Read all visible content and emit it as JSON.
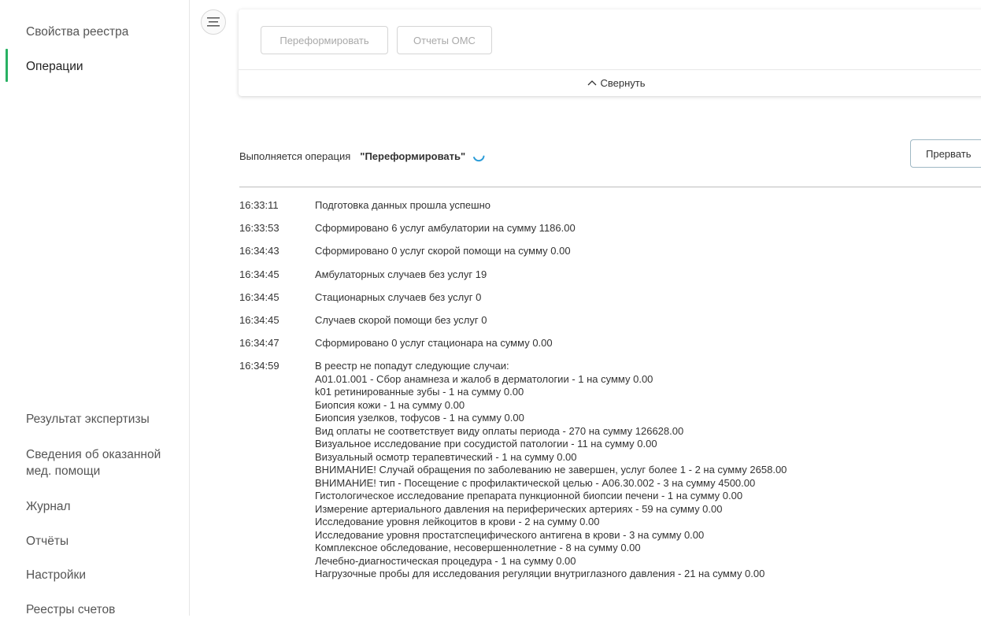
{
  "sidebar": {
    "top_items": [
      {
        "label": "Свойства реестра",
        "active": false
      },
      {
        "label": "Операции",
        "active": true
      }
    ],
    "bottom_items": [
      {
        "label": "Результат экспертизы"
      },
      {
        "label_line1": "Сведения об оказанной",
        "label_line2": "мед. помощи"
      },
      {
        "label": "Журнал"
      },
      {
        "label": "Отчёты"
      },
      {
        "label": "Настройки"
      },
      {
        "label": "Реестры счетов"
      }
    ],
    "active_color": "#28b163"
  },
  "card": {
    "buttons": [
      "Переформировать",
      "Отчеты ОМС"
    ],
    "collapse_label": "Свернуть"
  },
  "operation": {
    "prefix": "Выполняется операция",
    "name": "\"Переформировать\"",
    "abort_label": "Прервать",
    "spinner_color": "#2a9bd8"
  },
  "log": [
    {
      "time": "16:33:11",
      "text": "Подготовка данных прошла успешно"
    },
    {
      "time": "16:33:53",
      "text": "Сформировано 6 услуг амбулатории на сумму 1186.00"
    },
    {
      "time": "16:34:43",
      "text": "Сформировано 0 услуг скорой помощи на сумму 0.00"
    },
    {
      "time": "16:34:45",
      "text": "Амбулаторных случаев без услуг 19"
    },
    {
      "time": "16:34:45",
      "text": "Стационарных случаев без услуг 0"
    },
    {
      "time": "16:34:45",
      "text": "Случаев скорой помощи без услуг 0"
    },
    {
      "time": "16:34:47",
      "text": "Сформировано 0 услуг стационара на сумму 0.00"
    },
    {
      "time": "16:34:59",
      "lines": [
        "В реестр не попадут следующие случаи:",
        "A01.01.001 - Сбор анамнеза и жалоб в дерматологии - 1 на сумму 0.00",
        "k01 ретинированные зубы - 1 на сумму 0.00",
        "Биопсия кожи - 1 на сумму 0.00",
        "Биопсия узелков, тофусов - 1 на сумму 0.00",
        "Вид оплаты не соответствует виду оплаты периода - 270 на сумму 126628.00",
        "Визуальное исследование при сосудистой патологии - 11 на сумму 0.00",
        "Визуальный осмотр терапевтический - 1 на сумму 0.00",
        "ВНИМАНИЕ! Случай обращения по заболеванию не завершен, услуг более 1 - 2 на сумму 2658.00",
        "ВНИМАНИЕ! тип - Посещение с профилактической целью - A06.30.002 - 3 на сумму 4500.00",
        "Гистологическое исследование препарата пункционной биопсии печени - 1 на сумму 0.00",
        "Измерение артериального давления на периферических артериях - 59 на сумму 0.00",
        "Исследование уровня лейкоцитов в крови - 2 на сумму 0.00",
        "Исследование уровня простатспецифического антигена в крови - 3 на сумму 0.00",
        "Комплексное обследование, несовершеннолетние - 8 на сумму 0.00",
        "Лечебно-диагностическая процедура - 1 на сумму 0.00",
        "Нагрузочные пробы для исследования регуляции внутриглазного давления - 21 на сумму 0.00"
      ]
    }
  ]
}
